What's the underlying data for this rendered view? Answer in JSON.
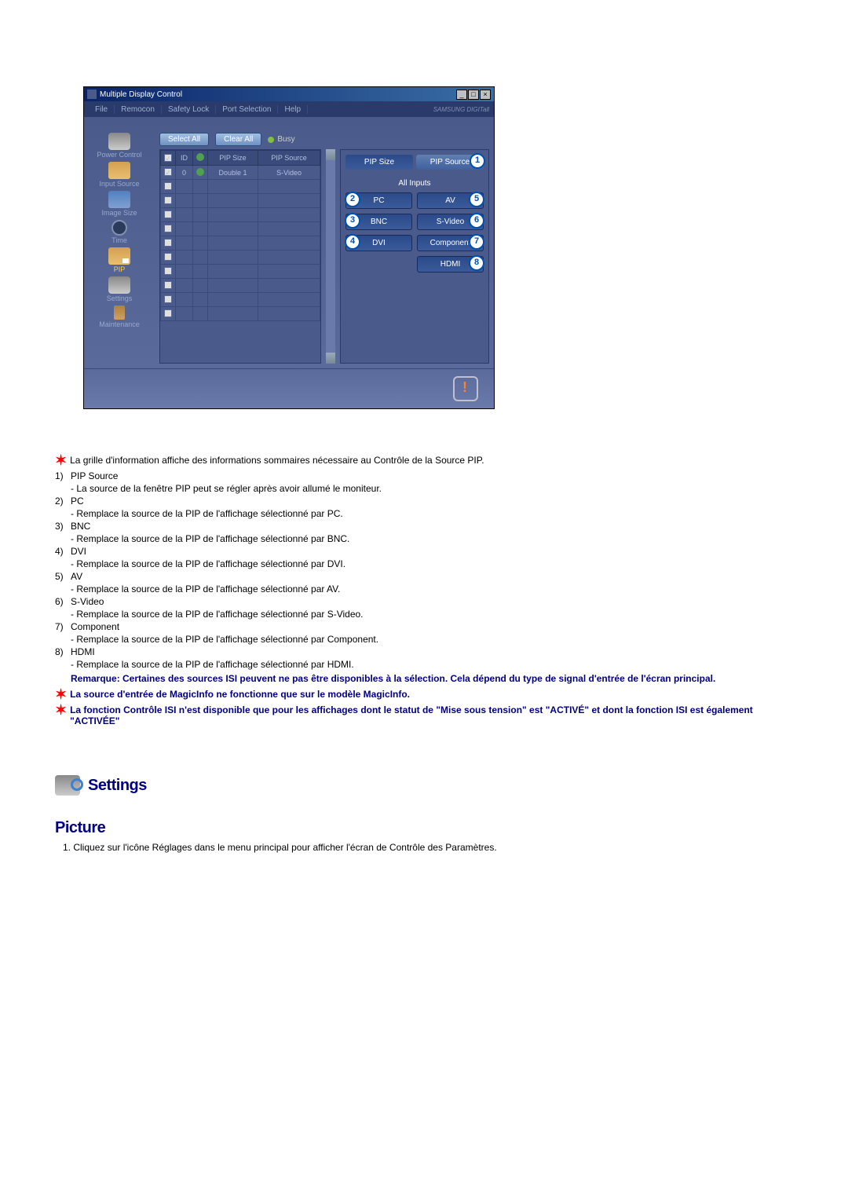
{
  "app": {
    "title": "Multiple Display Control",
    "menu": [
      "File",
      "Remocon",
      "Safety Lock",
      "Port Selection",
      "Help"
    ],
    "brand": "SAMSUNG DIGITall"
  },
  "sidebar": {
    "items": [
      {
        "label": "Power Control"
      },
      {
        "label": "Input Source"
      },
      {
        "label": "Image Size"
      },
      {
        "label": "Time"
      },
      {
        "label": "PIP"
      },
      {
        "label": "Settings"
      },
      {
        "label": "Maintenance"
      }
    ]
  },
  "toolbar": {
    "select_all": "Select All",
    "clear_all": "Clear All",
    "busy": "Busy"
  },
  "grid": {
    "headers": {
      "id": "ID",
      "size": "PIP Size",
      "source": "PIP Source"
    },
    "row": {
      "id": "0",
      "size": "Double 1",
      "source": "S-Video"
    }
  },
  "panel": {
    "tabs": {
      "size": "PIP Size",
      "source": "PIP Source"
    },
    "callout_source": "1",
    "all_inputs": "All Inputs",
    "buttons": {
      "pc": "PC",
      "av": "AV",
      "bnc": "BNC",
      "svideo": "S-Video",
      "dvi": "DVI",
      "component": "Component",
      "hdmi": "HDMI"
    },
    "callouts": {
      "pc": "2",
      "bnc": "3",
      "dvi": "4",
      "av": "5",
      "svideo": "6",
      "component": "7",
      "hdmi": "8"
    }
  },
  "doc": {
    "intro": "La grille d'information affiche des informations sommaires nécessaire au Contrôle de la Source PIP.",
    "items": [
      {
        "n": "1)",
        "t": "PIP Source",
        "d": "- La source de la fenêtre PIP peut se régler après avoir allumé le moniteur."
      },
      {
        "n": "2)",
        "t": "PC",
        "d": "- Remplace la source de la PIP de l'affichage sélectionné par PC."
      },
      {
        "n": "3)",
        "t": "BNC",
        "d": "- Remplace la source de la PIP de l'affichage sélectionné par BNC."
      },
      {
        "n": "4)",
        "t": "DVI",
        "d": "- Remplace la source de la PIP de l'affichage sélectionné par DVI."
      },
      {
        "n": "5)",
        "t": "AV",
        "d": "- Remplace la source de la PIP de l'affichage sélectionné par AV."
      },
      {
        "n": "6)",
        "t": "S-Video",
        "d": "- Remplace la source de la PIP de l'affichage sélectionné par S-Video."
      },
      {
        "n": "7)",
        "t": "Component",
        "d": "- Remplace la source de la PIP de l'affichage sélectionné par Component."
      },
      {
        "n": "8)",
        "t": "HDMI",
        "d": "- Remplace la source de la PIP de l'affichage sélectionné par HDMI."
      }
    ],
    "remark": "Remarque: Certaines des sources ISI peuvent ne pas être disponibles à la sélection. Cela dépend du type de signal d'entrée de l'écran principal.",
    "star2": "La source d'entrée de MagicInfo ne fonctionne que sur le modèle MagicInfo.",
    "star3": "La fonction Contrôle ISI n'est disponible que pour les affichages dont le statut de \"Mise sous tension\" est \"ACTIVÉ\" et dont la fonction ISI est également \"ACTIVÉE\"",
    "settings_title": "Settings",
    "picture_title": "Picture",
    "picture_step": "1.  Cliquez sur l'icône Réglages dans le menu principal pour afficher l'écran de Contrôle des Paramètres."
  }
}
